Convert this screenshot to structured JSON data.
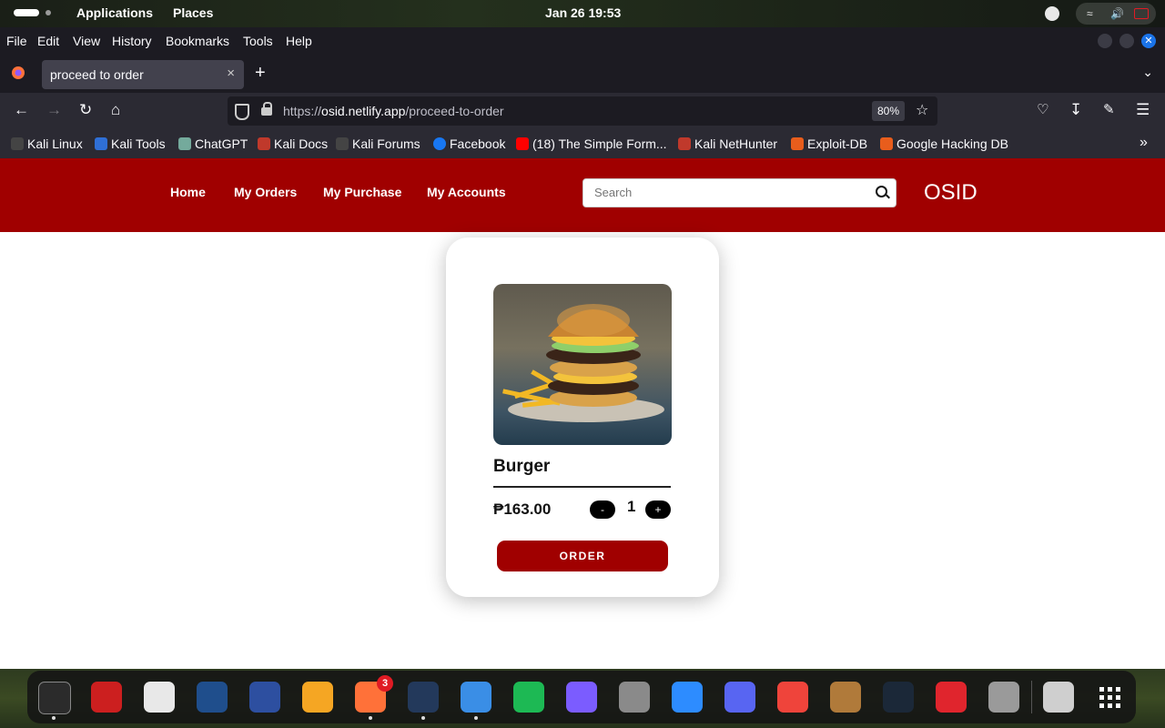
{
  "system": {
    "activities": "Applications",
    "places": "Places",
    "clock": "Jan 26  19:53"
  },
  "menu": [
    "File",
    "Edit",
    "View",
    "History",
    "Bookmarks",
    "Tools",
    "Help"
  ],
  "tab": {
    "title": "proceed to order"
  },
  "urlbar": {
    "prefix": "https://",
    "domain": "osid.netlify.app",
    "path": "/proceed-to-order",
    "zoom": "80%"
  },
  "bookmarks": [
    {
      "label": "Kali Linux",
      "color": "#444444"
    },
    {
      "label": "Kali Tools",
      "color": "#2f6fd6"
    },
    {
      "label": "ChatGPT",
      "color": "#74aa9c"
    },
    {
      "label": "Kali Docs",
      "color": "#c0392b"
    },
    {
      "label": "Kali Forums",
      "color": "#444444"
    },
    {
      "label": "Facebook",
      "color": "#1877f2"
    },
    {
      "label": "(18) The Simple Form...",
      "color": "#ff0000"
    },
    {
      "label": "Kali NetHunter",
      "color": "#c0392b"
    },
    {
      "label": "Exploit-DB",
      "color": "#e85d1c"
    },
    {
      "label": "Google Hacking DB",
      "color": "#e85d1c"
    }
  ],
  "site": {
    "nav": [
      "Home",
      "My Orders",
      "My Purchase",
      "My Accounts"
    ],
    "search_placeholder": "Search",
    "brand": "OSID",
    "header_color": "#a00000"
  },
  "product": {
    "name": "Burger",
    "price": "₱163.00",
    "quantity": "1",
    "minus": "-",
    "plus": "+",
    "order_label": "ORDER"
  },
  "dock": {
    "badge": "3",
    "apps": [
      {
        "name": "terminal",
        "color": "#2b2b2b"
      },
      {
        "name": "root-terminal",
        "color": "#cc1f1f"
      },
      {
        "name": "text-editor",
        "color": "#e8e8e8"
      },
      {
        "name": "metasploit",
        "color": "#1f4e8c"
      },
      {
        "name": "wireshark",
        "color": "#2d4fa0"
      },
      {
        "name": "vlc-media",
        "color": "#f5a623"
      },
      {
        "name": "firefox",
        "color": "#ff7139"
      },
      {
        "name": "vscode",
        "color": "#23395b"
      },
      {
        "name": "finder",
        "color": "#3a8ee6"
      },
      {
        "name": "spotify",
        "color": "#1db954"
      },
      {
        "name": "messenger",
        "color": "#7b5cff"
      },
      {
        "name": "settings",
        "color": "#8a8a8a"
      },
      {
        "name": "zoom",
        "color": "#2d8cff"
      },
      {
        "name": "discord",
        "color": "#5865f2"
      },
      {
        "name": "anydesk",
        "color": "#ef443b"
      },
      {
        "name": "game-character",
        "color": "#b07a3a"
      },
      {
        "name": "steam",
        "color": "#1b2838"
      },
      {
        "name": "acrobat",
        "color": "#e0252d"
      },
      {
        "name": "volume",
        "color": "#9a9a9a"
      },
      {
        "name": "trash",
        "color": "#cfcfcf"
      },
      {
        "name": "app-grid",
        "color": "#ffffff"
      }
    ]
  }
}
